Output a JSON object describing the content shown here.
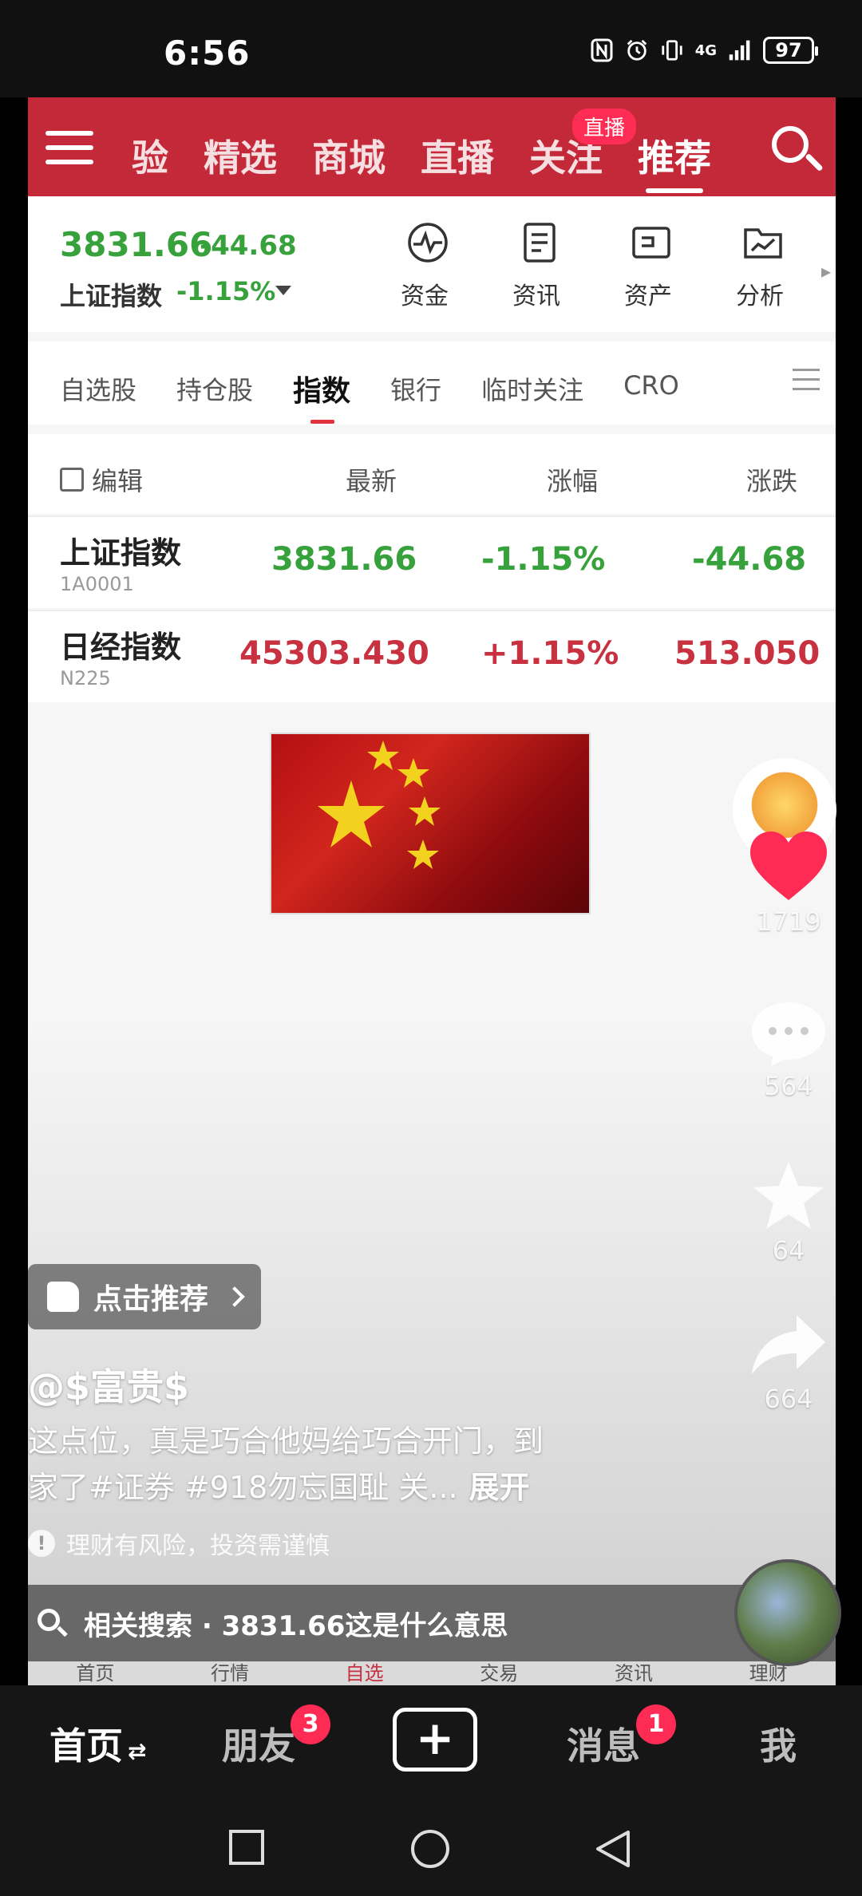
{
  "status_bar": {
    "time": "6:56",
    "network": "4G",
    "battery": "97"
  },
  "inner_app": {
    "feed_tabs": [
      "验",
      "精选",
      "商城",
      "直播",
      "关注",
      "推荐"
    ],
    "live_badge": "直播",
    "index_summary": {
      "value": "3831.66",
      "change": "-44.68",
      "name": "上证指数",
      "percent": "-1.15%"
    },
    "tools": [
      {
        "label": "资金",
        "icon": "pulse-icon"
      },
      {
        "label": "资讯",
        "icon": "document-icon"
      },
      {
        "label": "资产",
        "icon": "wallet-icon"
      },
      {
        "label": "分析",
        "icon": "chart-folder-icon"
      }
    ],
    "category_tabs": [
      "自选股",
      "持仓股",
      "指数",
      "银行",
      "临时关注",
      "CRO"
    ],
    "table_header": {
      "edit": "编辑",
      "latest": "最新",
      "change_pct": "涨幅",
      "change_amt": "涨跌"
    },
    "rows": [
      {
        "name": "上证指数",
        "code": "1A0001",
        "latest": "3831.66",
        "pct": "-1.15%",
        "amt": "-44.68"
      },
      {
        "name": "日经指数",
        "code": "N225",
        "latest": "45303.430",
        "pct": "+1.15%",
        "amt": "513.050"
      }
    ],
    "bottom_tabs": [
      "首页",
      "行情",
      "自选",
      "交易",
      "资讯",
      "理财"
    ]
  },
  "video_overlay": {
    "recommend_label": "点击推荐",
    "author": "@$富贵$",
    "caption_line1": "这点位，真是巧合他妈给巧合开门，到",
    "caption_line2": "家了#证券 #918勿忘国耻 关...",
    "expand_label": "展开",
    "risk_notice": "理财有风险，投资需谨慎",
    "related_search": "相关搜索 · 3831.66这是什么意思"
  },
  "actions": {
    "likes": "1719",
    "comments": "564",
    "favorites": "64",
    "shares": "664"
  },
  "bottom_nav": {
    "home": "首页",
    "friends": "朋友",
    "friends_badge": "3",
    "messages": "消息",
    "messages_badge": "1",
    "me": "我"
  },
  "colors": {
    "brand_red": "#c4293a",
    "down_green": "#37a13c",
    "up_red": "#c83140",
    "badge_pink": "#fe2c55"
  }
}
